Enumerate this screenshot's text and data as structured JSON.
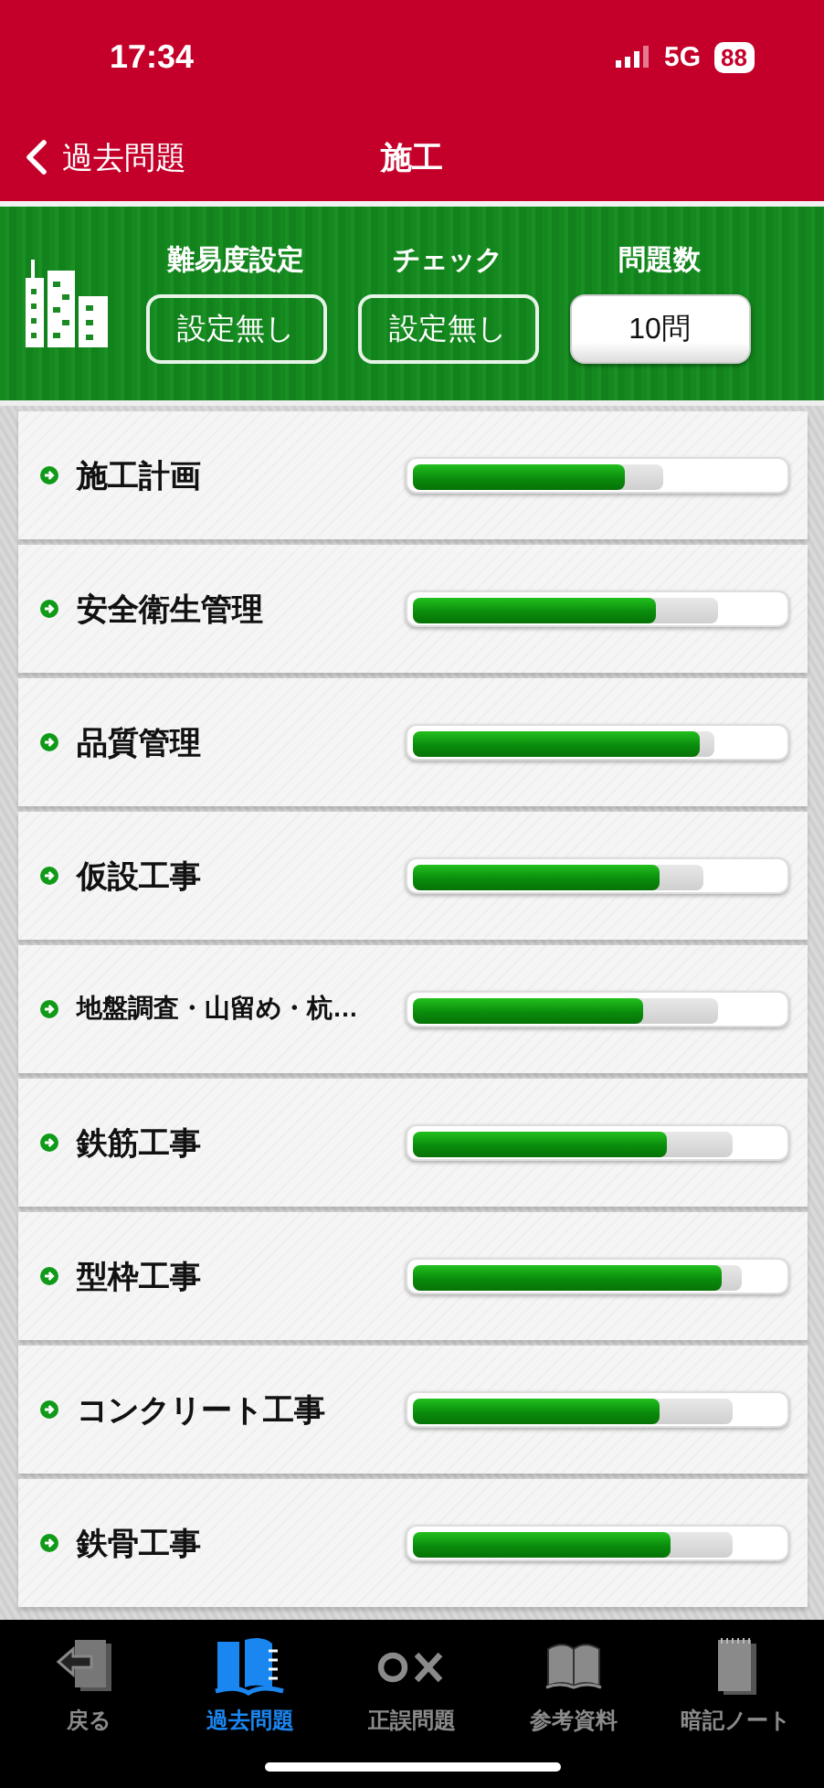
{
  "status_bar": {
    "time": "17:34",
    "network": "5G",
    "battery": "88"
  },
  "nav": {
    "back": "過去問題",
    "title": "施工"
  },
  "filters": [
    {
      "label": "難易度設定",
      "value": "設定無し",
      "kind": "outline"
    },
    {
      "label": "チェック",
      "value": "設定無し",
      "kind": "outline"
    },
    {
      "label": "問題数",
      "value": "10問",
      "kind": "solid"
    }
  ],
  "topics": [
    {
      "name": "施工計画",
      "answered": {
        "level": 0.67
      },
      "correct": {
        "level": 0.57
      }
    },
    {
      "name": "安全衛生管理",
      "answered": {
        "level": 0.82
      },
      "correct": {
        "level": 0.65
      }
    },
    {
      "name": "品質管理",
      "answered": {
        "level": 0.81
      },
      "correct": {
        "level": 0.77
      }
    },
    {
      "name": "仮設工事",
      "answered": {
        "level": 0.78
      },
      "correct": {
        "level": 0.66
      }
    },
    {
      "name": "地盤調査・山留め・杭…",
      "answered": {
        "level": 0.82
      },
      "correct": {
        "level": 0.62
      }
    },
    {
      "name": "鉄筋工事",
      "answered": {
        "level": 0.86
      },
      "correct": {
        "level": 0.68
      }
    },
    {
      "name": "型枠工事",
      "answered": {
        "level": 0.88
      },
      "correct": {
        "level": 0.83
      }
    },
    {
      "name": "コンクリート工事",
      "answered": {
        "level": 0.86
      },
      "correct": {
        "level": 0.66
      }
    },
    {
      "name": "鉄骨工事",
      "answered": {
        "level": 0.86
      },
      "correct": {
        "level": 0.69
      }
    }
  ],
  "tabs": [
    {
      "label": "戻る",
      "kind": "back",
      "selected": false
    },
    {
      "label": "過去問題",
      "kind": "book",
      "selected": true
    },
    {
      "label": "正誤問題",
      "kind": "ox",
      "selected": false
    },
    {
      "label": "参考資料",
      "kind": "open-book",
      "selected": false
    },
    {
      "label": "暗記ノート",
      "kind": "notebook",
      "selected": false
    }
  ]
}
